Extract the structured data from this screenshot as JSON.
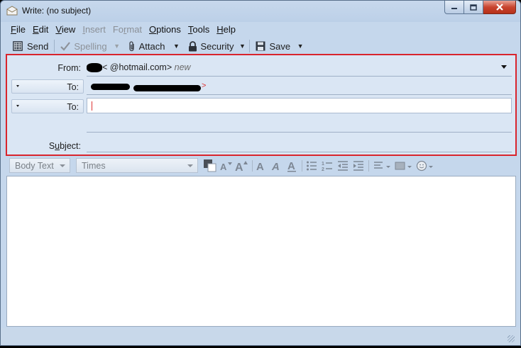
{
  "window": {
    "title": "Write: (no subject)"
  },
  "menubar": {
    "items": [
      {
        "label": "File",
        "accel": "F",
        "rest": "ile",
        "disabled": false
      },
      {
        "label": "Edit",
        "accel": "E",
        "rest": "dit",
        "disabled": false
      },
      {
        "label": "View",
        "accel": "V",
        "rest": "iew",
        "disabled": false
      },
      {
        "label": "Insert",
        "accel": "I",
        "rest": "nsert",
        "disabled": true
      },
      {
        "label": "Format",
        "pre": "Fo",
        "accel": "r",
        "rest": "mat",
        "disabled": true
      },
      {
        "label": "Options",
        "accel": "O",
        "rest": "ptions",
        "disabled": false
      },
      {
        "label": "Tools",
        "accel": "T",
        "rest": "ools",
        "disabled": false
      },
      {
        "label": "Help",
        "accel": "H",
        "rest": "elp",
        "disabled": false
      }
    ]
  },
  "toolbar": {
    "send_label": "Send",
    "spelling_label": "Spelling",
    "attach_label": "Attach",
    "security_label": "Security",
    "save_label": "Save"
  },
  "header": {
    "from_label": "From:",
    "from_address": "<   @hotmail.com>",
    "from_tag": "new",
    "to_label_1": "To:",
    "to_label_2": "To:",
    "subject_label_pre": "S",
    "subject_label_accel": "u",
    "subject_label_rest": "bject:",
    "subject_value": ""
  },
  "format_toolbar": {
    "paragraph_style": "Body Text",
    "font_family": "Times"
  },
  "colors": {
    "highlight_border": "#d9242c",
    "chrome": "#c5d7ec"
  }
}
